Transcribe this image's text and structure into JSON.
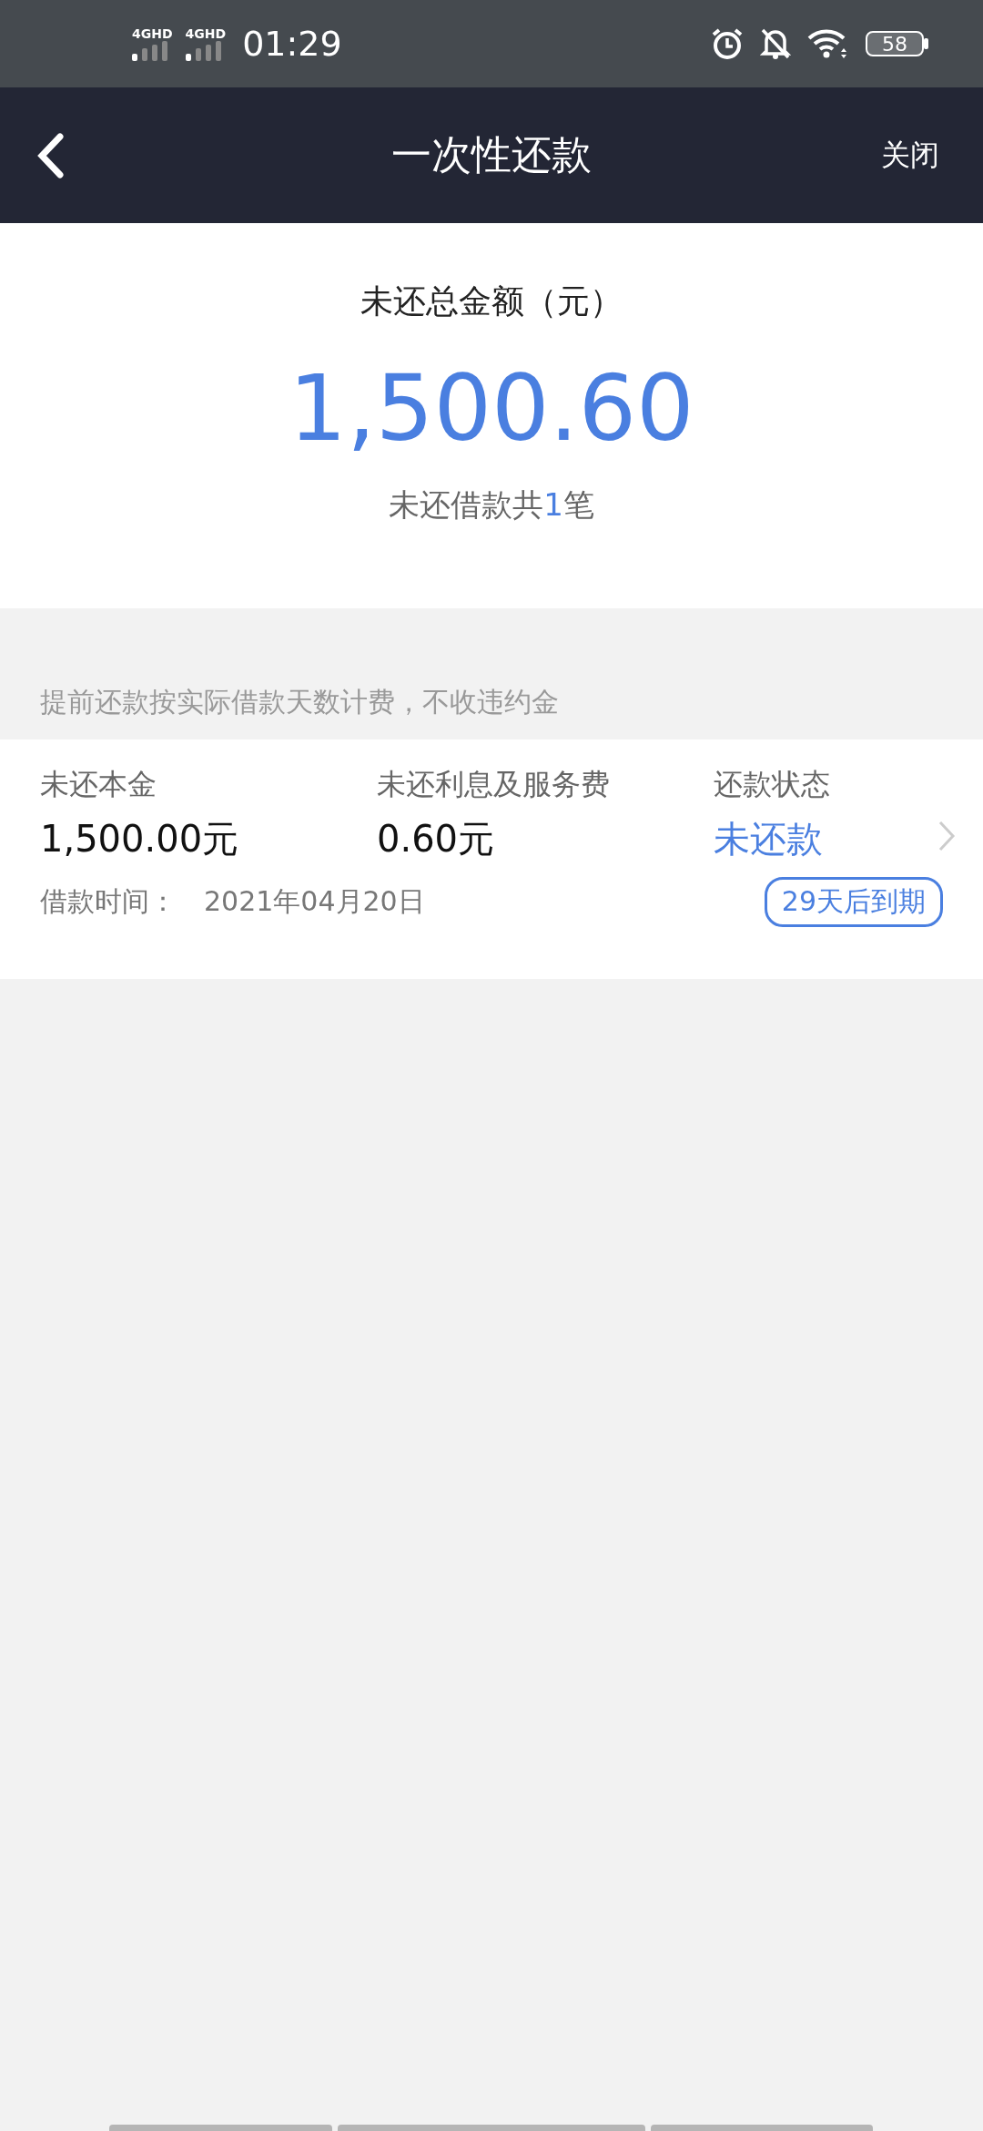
{
  "status_bar": {
    "networks": [
      "4GHD",
      "4GHD"
    ],
    "time": "01:29",
    "battery": "58"
  },
  "nav": {
    "title": "一次性还款",
    "close": "关闭"
  },
  "summary": {
    "label": "未还总金额（元）",
    "amount": "1,500.60",
    "count_prefix": "未还借款共",
    "count": "1",
    "count_suffix": "笔"
  },
  "tip": "提前还款按实际借款天数计费，不收违约金",
  "loans": [
    {
      "columns": [
        {
          "label": "未还本金",
          "value": "1,500.00元",
          "kind": "plain"
        },
        {
          "label": "未还利息及服务费",
          "value": "0.60元",
          "kind": "plain"
        },
        {
          "label": "还款状态",
          "value": "未还款",
          "kind": "status"
        }
      ],
      "date_label": "借款时间：",
      "date": "2021年04月20日",
      "due": "29天后到期"
    }
  ]
}
